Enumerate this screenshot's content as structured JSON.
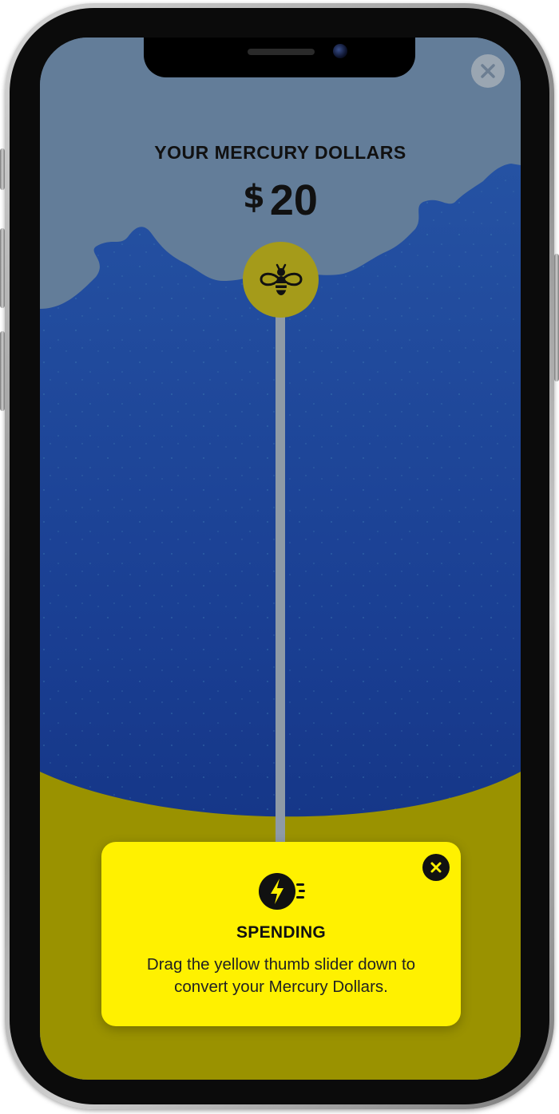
{
  "header": {
    "label": "YOUR MERCURY DOLLARS",
    "currency_symbol": "$",
    "amount": "20"
  },
  "top_close": {
    "icon": "close-icon"
  },
  "slider": {
    "thumb_icon": "bee-icon"
  },
  "popup": {
    "icon": "lightning-speed-icon",
    "title": "SPENDING",
    "text_line1": "Drag the yellow thumb slider down to",
    "text_line2": "convert your Mercury Dollars.",
    "close_icon": "close-icon"
  },
  "colors": {
    "sky": "#637d99",
    "water_blue": "#1a3d8f",
    "ground_olive": "#9a9200",
    "popup_yellow": "#fff100",
    "thumb": "#a59b1a"
  }
}
